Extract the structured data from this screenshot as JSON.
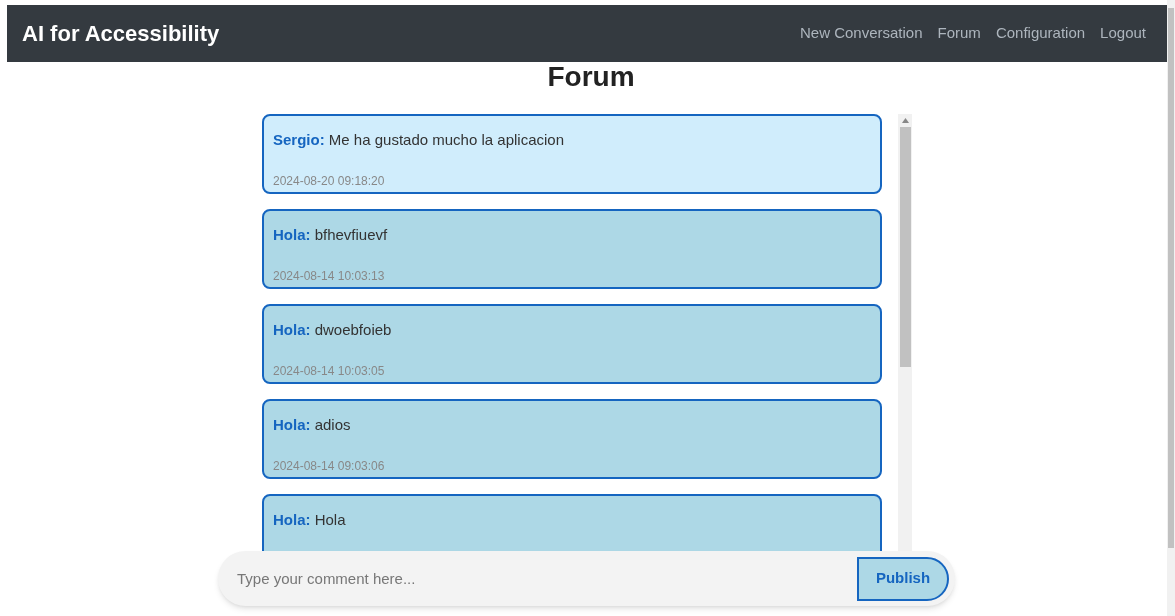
{
  "navbar": {
    "brand": "AI for Accessibility",
    "links": [
      "New Conversation",
      "Forum",
      "Configuration",
      "Logout"
    ]
  },
  "title": "Forum",
  "posts": [
    {
      "author": "Sergio:",
      "text": "Me ha gustado mucho la aplicacion",
      "time": "2024-08-20 09:18:20",
      "highlighted": true
    },
    {
      "author": "Hola:",
      "text": "bfhevfiuevf",
      "time": "2024-08-14 10:03:13",
      "highlighted": false
    },
    {
      "author": "Hola:",
      "text": "dwoebfoieb",
      "time": "2024-08-14 10:03:05",
      "highlighted": false
    },
    {
      "author": "Hola:",
      "text": "adios",
      "time": "2024-08-14 09:03:06",
      "highlighted": false
    },
    {
      "author": "Hola:",
      "text": "Hola",
      "highlighted": false
    }
  ],
  "composer": {
    "placeholder": "Type your comment here...",
    "button": "Publish"
  }
}
